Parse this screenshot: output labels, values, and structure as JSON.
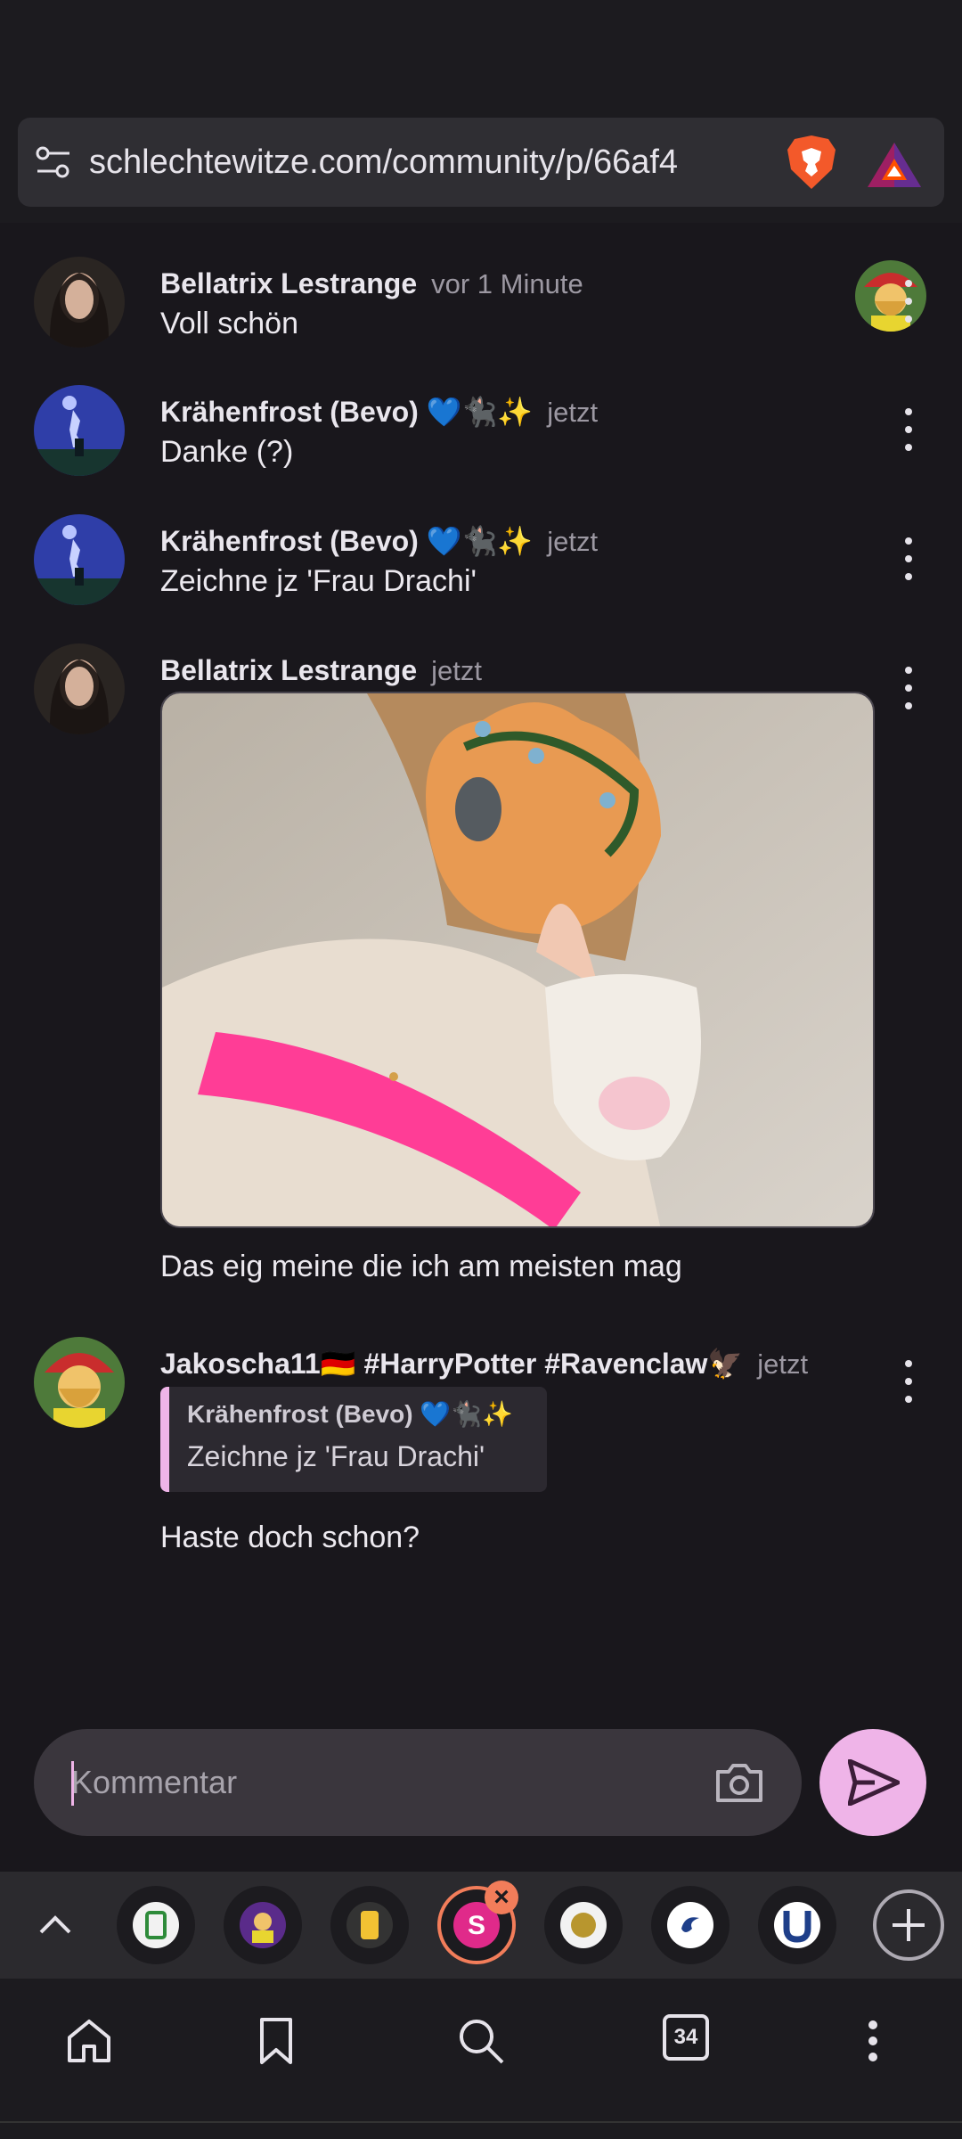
{
  "browser": {
    "url": "schlechtewitze.com/community/p/66af4",
    "tab_count": "34"
  },
  "comments": [
    {
      "author": "Bellatrix Lestrange",
      "time": "vor 1 Minute",
      "text": "Voll schön",
      "avatar": "dark-portrait"
    },
    {
      "author": "Krähenfrost (Bevo) 💙🐈‍⬛✨",
      "time": "jetzt",
      "text": "Danke (?)",
      "avatar": "night-sky"
    },
    {
      "author": "Krähenfrost (Bevo) 💙🐈‍⬛✨",
      "time": "jetzt",
      "text": "Zeichne jz 'Frau Drachi'",
      "avatar": "night-sky"
    },
    {
      "author": "Bellatrix Lestrange",
      "time": "jetzt",
      "text": "Das eig meine die ich am meisten mag",
      "avatar": "dark-portrait",
      "has_image": true
    },
    {
      "author": "Jakoscha11🇩🇪 #HarryPotter #Ravenclaw🦅",
      "time": "jetzt",
      "quote": {
        "author": "Krähenfrost (Bevo) 💙🐈‍⬛✨",
        "text": "Zeichne jz 'Frau Drachi'"
      },
      "text": "Haste doch schon?",
      "avatar": "cartoon-elf"
    }
  ],
  "composer": {
    "placeholder": "Kommentar"
  },
  "colors": {
    "accent": "#efb4e8",
    "background": "#19171c",
    "active_tab": "#f27d5a"
  }
}
